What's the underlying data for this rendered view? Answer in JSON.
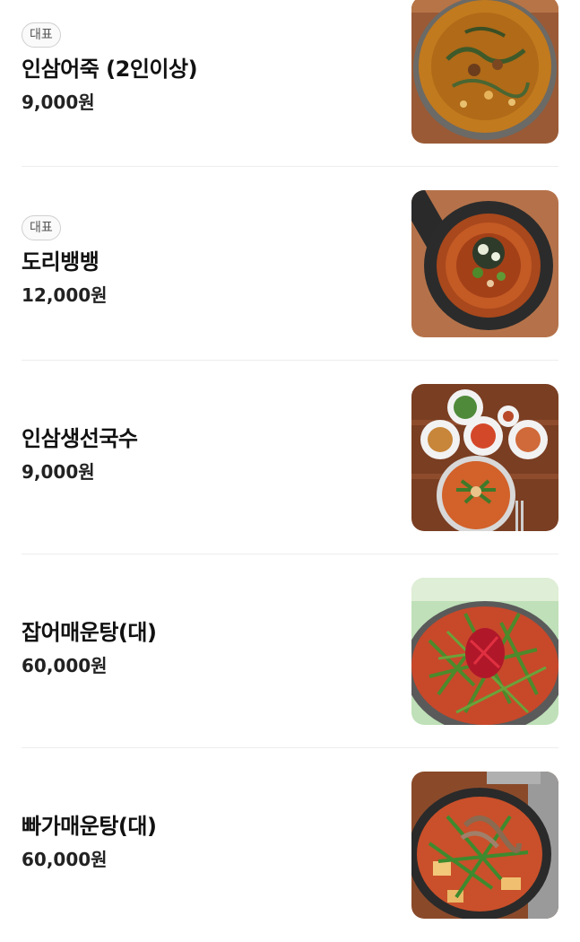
{
  "menu": {
    "items": [
      {
        "badge": "대표",
        "name": "인삼어죽 (2인이상)",
        "price": "9,000원",
        "image": "fish-porridge-photo"
      },
      {
        "badge": "대표",
        "name": "도리뱅뱅",
        "price": "12,000원",
        "image": "fried-fish-pan-photo"
      },
      {
        "badge": "",
        "name": "인삼생선국수",
        "price": "9,000원",
        "image": "fish-noodle-soup-photo"
      },
      {
        "badge": "",
        "name": "잡어매운탕(대)",
        "price": "60,000원",
        "image": "spicy-fish-stew-photo"
      },
      {
        "badge": "",
        "name": "빠가매운탕(대)",
        "price": "60,000원",
        "image": "catfish-spicy-stew-photo"
      }
    ]
  }
}
